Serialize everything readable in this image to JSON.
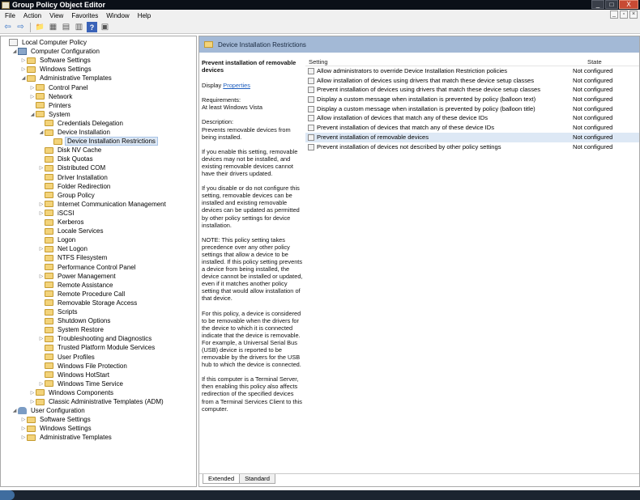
{
  "window": {
    "title": "Group Policy Object Editor",
    "caption": [
      "_",
      "□",
      "X"
    ],
    "mdi": [
      "_",
      "▫",
      "×"
    ]
  },
  "menu": [
    "File",
    "Action",
    "View",
    "Favorites",
    "Window",
    "Help"
  ],
  "toolbar": {
    "icons": [
      "back-icon",
      "forward-icon",
      "up-folder-icon",
      "show-hide-tree-icon",
      "properties-icon",
      "export-icon",
      "help-icon",
      "console-icon"
    ],
    "glyphs": [
      "⇦",
      "⇨",
      "📁",
      "▦",
      "▤",
      "▥",
      "?",
      "▣"
    ]
  },
  "tree": [
    {
      "label": "Local Computer Policy",
      "level": 0,
      "exp": "",
      "icon": "document"
    },
    {
      "label": "Computer Configuration",
      "level": 1,
      "exp": "◢",
      "icon": "computer"
    },
    {
      "label": "Software Settings",
      "level": 2,
      "exp": "▷",
      "icon": "folder"
    },
    {
      "label": "Windows Settings",
      "level": 2,
      "exp": "▷",
      "icon": "folder"
    },
    {
      "label": "Administrative Templates",
      "level": 2,
      "exp": "◢",
      "icon": "folder"
    },
    {
      "label": "Control Panel",
      "level": 3,
      "exp": "▷",
      "icon": "folder"
    },
    {
      "label": "Network",
      "level": 3,
      "exp": "▷",
      "icon": "folder"
    },
    {
      "label": "Printers",
      "level": 3,
      "exp": "",
      "icon": "folder"
    },
    {
      "label": "System",
      "level": 3,
      "exp": "◢",
      "icon": "folder"
    },
    {
      "label": "Credentials Delegation",
      "level": 4,
      "exp": "",
      "icon": "folder"
    },
    {
      "label": "Device Installation",
      "level": 4,
      "exp": "◢",
      "icon": "folder"
    },
    {
      "label": "Device Installation Restrictions",
      "level": 5,
      "exp": "",
      "icon": "folder",
      "selected": true
    },
    {
      "label": "Disk NV Cache",
      "level": 4,
      "exp": "",
      "icon": "folder"
    },
    {
      "label": "Disk Quotas",
      "level": 4,
      "exp": "",
      "icon": "folder"
    },
    {
      "label": "Distributed COM",
      "level": 4,
      "exp": "▷",
      "icon": "folder"
    },
    {
      "label": "Driver Installation",
      "level": 4,
      "exp": "",
      "icon": "folder"
    },
    {
      "label": "Folder Redirection",
      "level": 4,
      "exp": "",
      "icon": "folder"
    },
    {
      "label": "Group Policy",
      "level": 4,
      "exp": "",
      "icon": "folder"
    },
    {
      "label": "Internet Communication Management",
      "level": 4,
      "exp": "▷",
      "icon": "folder"
    },
    {
      "label": "iSCSI",
      "level": 4,
      "exp": "▷",
      "icon": "folder"
    },
    {
      "label": "Kerberos",
      "level": 4,
      "exp": "",
      "icon": "folder"
    },
    {
      "label": "Locale Services",
      "level": 4,
      "exp": "",
      "icon": "folder"
    },
    {
      "label": "Logon",
      "level": 4,
      "exp": "",
      "icon": "folder"
    },
    {
      "label": "Net Logon",
      "level": 4,
      "exp": "▷",
      "icon": "folder"
    },
    {
      "label": "NTFS Filesystem",
      "level": 4,
      "exp": "",
      "icon": "folder"
    },
    {
      "label": "Performance Control Panel",
      "level": 4,
      "exp": "",
      "icon": "folder"
    },
    {
      "label": "Power Management",
      "level": 4,
      "exp": "▷",
      "icon": "folder"
    },
    {
      "label": "Remote Assistance",
      "level": 4,
      "exp": "",
      "icon": "folder"
    },
    {
      "label": "Remote Procedure Call",
      "level": 4,
      "exp": "",
      "icon": "folder"
    },
    {
      "label": "Removable Storage Access",
      "level": 4,
      "exp": "",
      "icon": "folder"
    },
    {
      "label": "Scripts",
      "level": 4,
      "exp": "",
      "icon": "folder"
    },
    {
      "label": "Shutdown Options",
      "level": 4,
      "exp": "",
      "icon": "folder"
    },
    {
      "label": "System Restore",
      "level": 4,
      "exp": "",
      "icon": "folder"
    },
    {
      "label": "Troubleshooting and Diagnostics",
      "level": 4,
      "exp": "▷",
      "icon": "folder"
    },
    {
      "label": "Trusted Platform Module Services",
      "level": 4,
      "exp": "",
      "icon": "folder"
    },
    {
      "label": "User Profiles",
      "level": 4,
      "exp": "",
      "icon": "folder"
    },
    {
      "label": "Windows File Protection",
      "level": 4,
      "exp": "",
      "icon": "folder"
    },
    {
      "label": "Windows HotStart",
      "level": 4,
      "exp": "",
      "icon": "folder"
    },
    {
      "label": "Windows Time Service",
      "level": 4,
      "exp": "▷",
      "icon": "folder"
    },
    {
      "label": "Windows Components",
      "level": 3,
      "exp": "▷",
      "icon": "folder"
    },
    {
      "label": "Classic Administrative Templates (ADM)",
      "level": 3,
      "exp": "▷",
      "icon": "folder"
    },
    {
      "label": "User Configuration",
      "level": 1,
      "exp": "◢",
      "icon": "user"
    },
    {
      "label": "Software Settings",
      "level": 2,
      "exp": "▷",
      "icon": "folder"
    },
    {
      "label": "Windows Settings",
      "level": 2,
      "exp": "▷",
      "icon": "folder"
    },
    {
      "label": "Administrative Templates",
      "level": 2,
      "exp": "▷",
      "icon": "folder"
    }
  ],
  "detail": {
    "header": "Device Installation Restrictions",
    "desc_title": "Prevent installation of removable devices",
    "display_label": "Display",
    "properties_link": "Properties",
    "requirements": "Requirements:\nAt least Windows Vista",
    "description": "Description:\nPrevents removable devices from being installed.",
    "p1": "If you enable this setting, removable devices may not be installed, and existing removable devices cannot have their drivers updated.",
    "p2": "If you disable or do not configure this setting, removable devices can be installed and existing removable devices can be updated as permitted by other policy settings for device installation.",
    "p3": "NOTE: This policy setting takes precedence over any other policy settings that allow a device to be installed. If this policy setting prevents a device from being installed, the device cannot be installed or updated, even if it matches another policy setting that would allow installation of that device.",
    "p4": "For this policy, a device is considered to be removable when the drivers for the device to which it is connected indicate that the device is removable. For example, a Universal Serial Bus (USB) device is reported to be removable by the drivers for the USB hub to which the device is connected.",
    "p5": "If this computer is a Terminal Server, then enabling this policy also affects redirection of the specified devices from a Terminal Services Client to this computer."
  },
  "list": {
    "col_setting": "Setting",
    "col_state": "State",
    "rows": [
      {
        "name": "Allow administrators to override Device Installation Restriction policies",
        "state": "Not configured"
      },
      {
        "name": "Allow installation of devices using drivers that match these device setup classes",
        "state": "Not configured"
      },
      {
        "name": "Prevent installation of devices using drivers that match these device setup classes",
        "state": "Not configured"
      },
      {
        "name": "Display a custom message when installation is prevented by policy (balloon text)",
        "state": "Not configured"
      },
      {
        "name": "Display a custom message when installation is prevented by policy (balloon title)",
        "state": "Not configured"
      },
      {
        "name": "Allow installation of devices that match any of these device IDs",
        "state": "Not configured"
      },
      {
        "name": "Prevent installation of devices that match any of these device IDs",
        "state": "Not configured"
      },
      {
        "name": "Prevent installation of removable devices",
        "state": "Not configured",
        "selected": true
      },
      {
        "name": "Prevent installation of devices not described by other policy settings",
        "state": "Not configured"
      }
    ]
  },
  "tabs": [
    "Extended",
    "Standard"
  ],
  "colors": {
    "titlebar": "#0b1018",
    "header": "#a3b9d6",
    "selection": "#dde8f5",
    "link": "#1f5fbf"
  }
}
